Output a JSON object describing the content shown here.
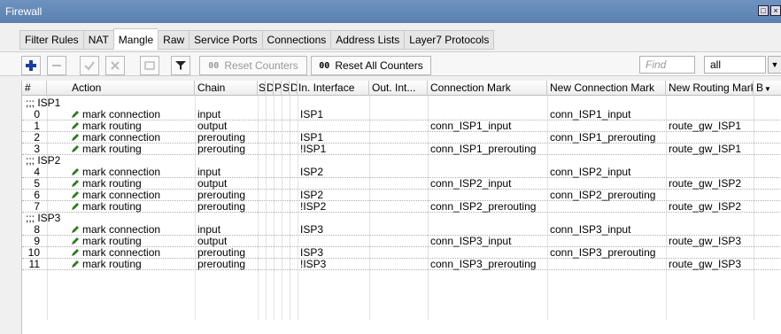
{
  "window": {
    "title": "Firewall"
  },
  "tabs": [
    "Filter Rules",
    "NAT",
    "Mangle",
    "Raw",
    "Service Ports",
    "Connections",
    "Address Lists",
    "Layer7 Protocols"
  ],
  "active_tab": "Mangle",
  "toolbar": {
    "reset_counters": "Reset Counters",
    "reset_all_counters": "Reset All Counters",
    "counter_glyph": "00",
    "find_placeholder": "Find",
    "filter_value": "all"
  },
  "columns": {
    "num": "#",
    "action": "Action",
    "chain": "Chain",
    "s1": "S",
    "d1": "D",
    "p": "P",
    "s2": "S",
    "d2": "D",
    "in_interface": "In. Interface",
    "out_interface": "Out. Int...",
    "connection_mark": "Connection Mark",
    "new_connection_mark": "New Connection Mark",
    "new_routing_mark": "New Routing Mark",
    "b": "B"
  },
  "groups": [
    {
      "comment": ";;; ISP1",
      "rows": [
        {
          "num": "0",
          "action": "mark connection",
          "chain": "input",
          "in": "ISP1",
          "conn_mark": "",
          "new_conn_mark": "conn_ISP1_input",
          "new_routing_mark": ""
        },
        {
          "num": "1",
          "action": "mark routing",
          "chain": "output",
          "in": "",
          "conn_mark": "conn_ISP1_input",
          "new_conn_mark": "",
          "new_routing_mark": "route_gw_ISP1"
        },
        {
          "num": "2",
          "action": "mark connection",
          "chain": "prerouting",
          "in": "ISP1",
          "conn_mark": "",
          "new_conn_mark": "conn_ISP1_prerouting",
          "new_routing_mark": ""
        },
        {
          "num": "3",
          "action": "mark routing",
          "chain": "prerouting",
          "in": "!ISP1",
          "conn_mark": "conn_ISP1_prerouting",
          "new_conn_mark": "",
          "new_routing_mark": "route_gw_ISP1"
        }
      ]
    },
    {
      "comment": ";;; ISP2",
      "rows": [
        {
          "num": "4",
          "action": "mark connection",
          "chain": "input",
          "in": "ISP2",
          "conn_mark": "",
          "new_conn_mark": "conn_ISP2_input",
          "new_routing_mark": ""
        },
        {
          "num": "5",
          "action": "mark routing",
          "chain": "output",
          "in": "",
          "conn_mark": "conn_ISP2_input",
          "new_conn_mark": "",
          "new_routing_mark": "route_gw_ISP2"
        },
        {
          "num": "6",
          "action": "mark connection",
          "chain": "prerouting",
          "in": "ISP2",
          "conn_mark": "",
          "new_conn_mark": "conn_ISP2_prerouting",
          "new_routing_mark": ""
        },
        {
          "num": "7",
          "action": "mark routing",
          "chain": "prerouting",
          "in": "!ISP2",
          "conn_mark": "conn_ISP2_prerouting",
          "new_conn_mark": "",
          "new_routing_mark": "route_gw_ISP2"
        }
      ]
    },
    {
      "comment": ";;; ISP3",
      "rows": [
        {
          "num": "8",
          "action": "mark connection",
          "chain": "input",
          "in": "ISP3",
          "conn_mark": "",
          "new_conn_mark": "conn_ISP3_input",
          "new_routing_mark": ""
        },
        {
          "num": "9",
          "action": "mark routing",
          "chain": "output",
          "in": "",
          "conn_mark": "conn_ISP3_input",
          "new_conn_mark": "",
          "new_routing_mark": "route_gw_ISP3"
        },
        {
          "num": "10",
          "action": "mark connection",
          "chain": "prerouting",
          "in": "ISP3",
          "conn_mark": "",
          "new_conn_mark": "conn_ISP3_prerouting",
          "new_routing_mark": ""
        },
        {
          "num": "11",
          "action": "mark routing",
          "chain": "prerouting",
          "in": "!ISP3",
          "conn_mark": "conn_ISP3_prerouting",
          "new_conn_mark": "",
          "new_routing_mark": "route_gw_ISP3"
        }
      ]
    }
  ]
}
